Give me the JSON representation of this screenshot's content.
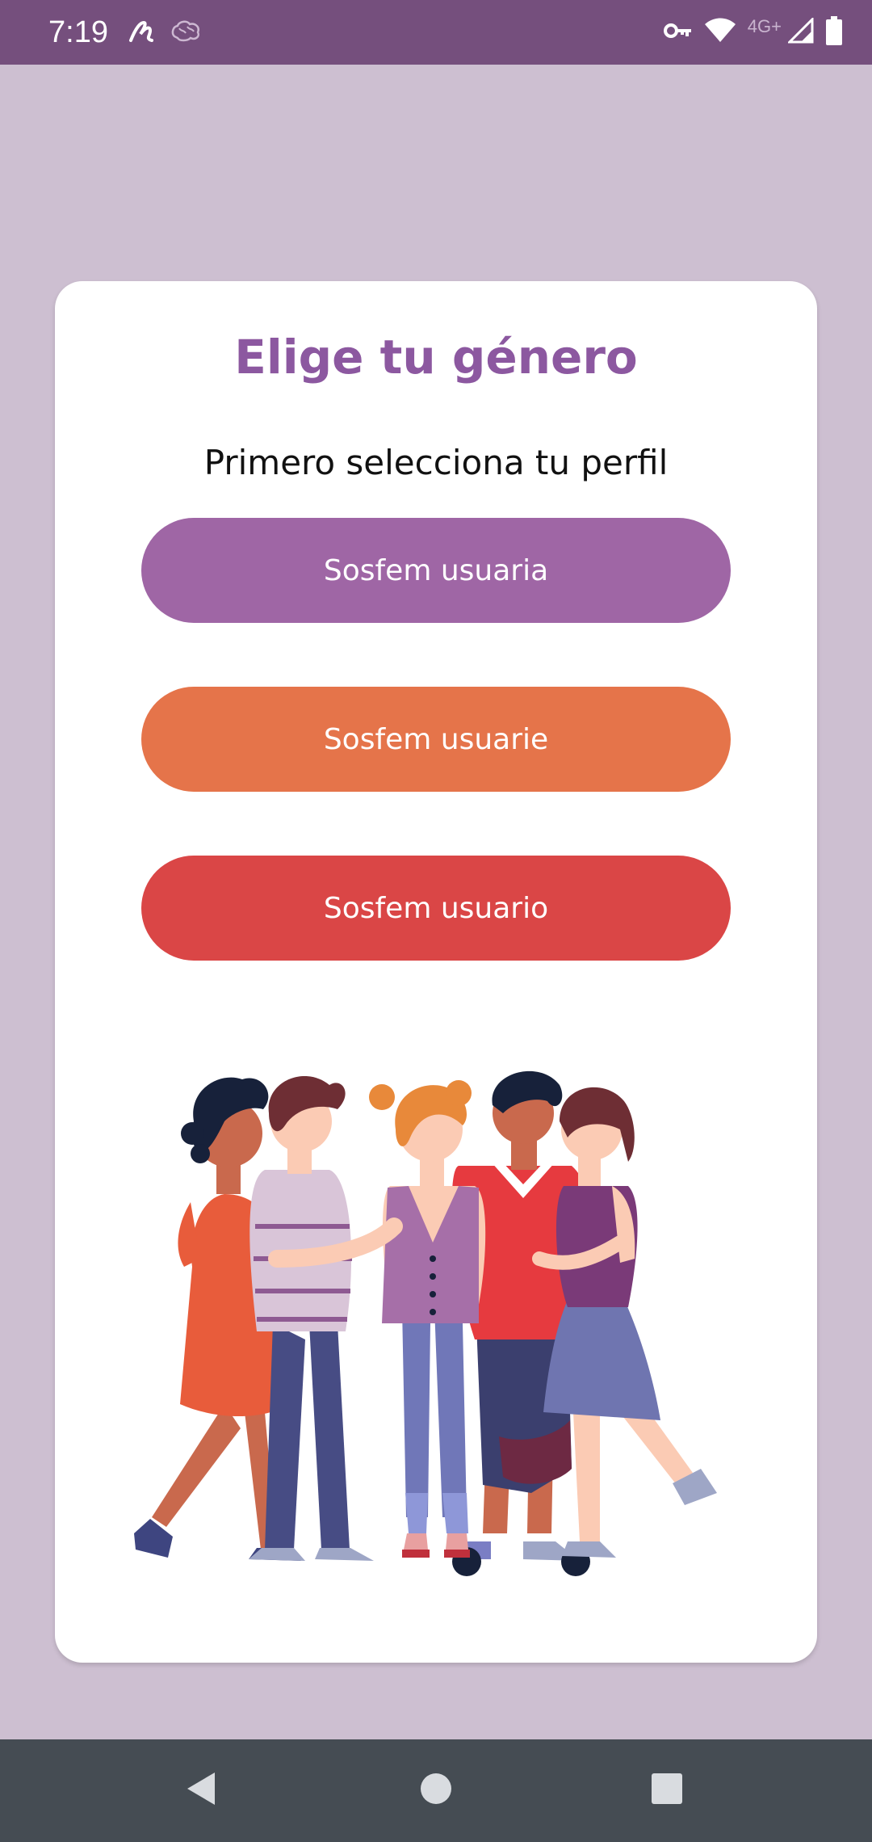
{
  "status_bar": {
    "time": "7:19",
    "network_label": "4G+",
    "icons": [
      "link-icon",
      "brain-icon",
      "vpn-key-icon",
      "wifi-icon",
      "signal-icon",
      "battery-icon"
    ],
    "background_color": "#754f7d"
  },
  "card": {
    "title": "Elige tu género",
    "subtitle": "Primero selecciona tu perfil",
    "title_color": "#8c58a0"
  },
  "buttons": [
    {
      "label": "Sosfem usuaria",
      "color": "#9f66a5"
    },
    {
      "label": "Sosfem usuarie",
      "color": "#e5744a"
    },
    {
      "label": "Sosfem usuario",
      "color": "#da4646"
    }
  ],
  "illustration": {
    "icon": "group-of-friends-illustration"
  },
  "nav_bar": {
    "icons": [
      "back-icon",
      "home-icon",
      "recent-apps-icon"
    ],
    "background_color": "#454c53"
  },
  "page_background": "#cdbfd1"
}
